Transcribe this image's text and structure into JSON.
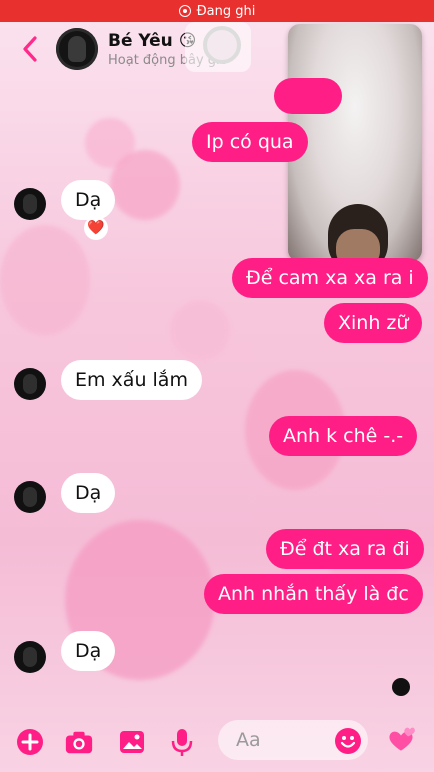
{
  "status_bar": {
    "recording_text": "Đang ghi"
  },
  "header": {
    "title": "Bé Yêu",
    "title_emoji": "😘",
    "subtitle": "Hoạt động bây giờ",
    "back_icon": "chevron-left-icon"
  },
  "messages": [
    {
      "side": "out",
      "text": "Ip có qua"
    },
    {
      "side": "in",
      "text": "Dạ",
      "reaction": "❤️"
    },
    {
      "side": "out",
      "text": "Để cam xa xa ra i"
    },
    {
      "side": "out",
      "text": "Xinh zữ"
    },
    {
      "side": "in",
      "text": "Em xấu lắm"
    },
    {
      "side": "out",
      "text": "Anh k chê -.-"
    },
    {
      "side": "in",
      "text": "Dạ"
    },
    {
      "side": "out",
      "text": "Để đt xa ra đi"
    },
    {
      "side": "out",
      "text": "Anh nhắn thấy là đc"
    },
    {
      "side": "in",
      "text": "Dạ"
    }
  ],
  "composer": {
    "placeholder": "Aa",
    "icons": [
      "plus-icon",
      "camera-icon",
      "image-icon",
      "microphone-icon",
      "emoji-icon",
      "hearts-icon"
    ]
  },
  "colors": {
    "accent": "#ff1e85",
    "recording": "#e8302e"
  }
}
